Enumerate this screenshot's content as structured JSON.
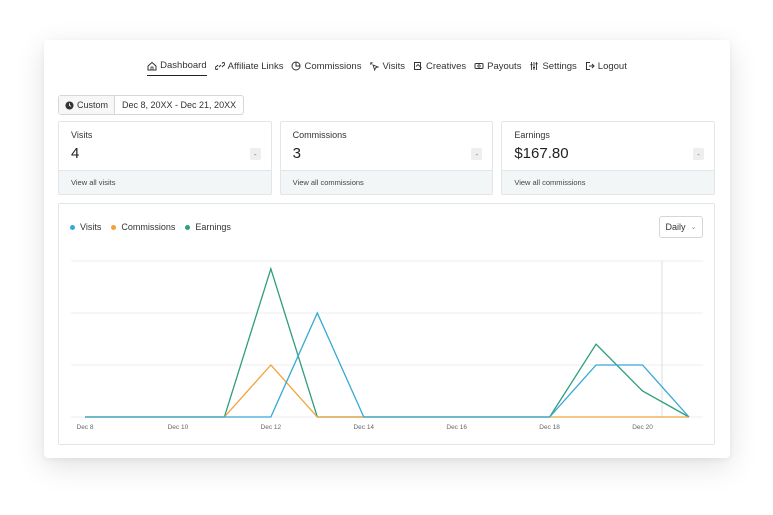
{
  "nav": {
    "items": [
      {
        "label": "Dashboard",
        "icon": "home-icon",
        "active": true
      },
      {
        "label": "Affiliate Links",
        "icon": "link-icon",
        "active": false
      },
      {
        "label": "Commissions",
        "icon": "pie-icon",
        "active": false
      },
      {
        "label": "Visits",
        "icon": "cursor-click-icon",
        "active": false
      },
      {
        "label": "Creatives",
        "icon": "image-icon",
        "active": false
      },
      {
        "label": "Payouts",
        "icon": "money-icon",
        "active": false
      },
      {
        "label": "Settings",
        "icon": "sliders-icon",
        "active": false
      },
      {
        "label": "Logout",
        "icon": "logout-icon",
        "active": false
      }
    ]
  },
  "date_range": {
    "preset": "Custom",
    "range": "Dec 8, 20XX - Dec 21, 20XX"
  },
  "stats": [
    {
      "label": "Visits",
      "value": "4",
      "chip": "-",
      "link": "View all visits"
    },
    {
      "label": "Commissions",
      "value": "3",
      "chip": "-",
      "link": "View all commissions"
    },
    {
      "label": "Earnings",
      "value": "$167.80",
      "chip": "-",
      "link": "View all commissions"
    }
  ],
  "interval": "Daily",
  "colors": {
    "visits": "#36a8d6",
    "commissions": "#f0a33a",
    "earnings": "#2e9e7e",
    "grid": "#ececec"
  },
  "chart_data": {
    "type": "line",
    "x": [
      "Dec 8",
      "Dec 9",
      "Dec 10",
      "Dec 11",
      "Dec 12",
      "Dec 13",
      "Dec 14",
      "Dec 15",
      "Dec 16",
      "Dec 17",
      "Dec 18",
      "Dec 19",
      "Dec 20",
      "Dec 21"
    ],
    "x_tick_labels": [
      "Dec 8",
      "Dec 10",
      "Dec 12",
      "Dec 14",
      "Dec 16",
      "Dec 18",
      "Dec 20"
    ],
    "series": [
      {
        "name": "Visits",
        "color": "#36a8d6",
        "values": [
          0,
          0,
          0,
          0,
          0,
          0,
          0,
          0,
          0,
          0,
          0,
          0,
          0,
          0,
          0,
          0,
          0,
          0,
          0,
          0,
          0,
          0,
          0,
          0,
          0,
          0,
          0
        ],
        "points": [
          [
            0,
            0
          ],
          [
            1,
            0
          ],
          [
            2,
            0
          ],
          [
            3,
            0
          ],
          [
            4,
            0
          ],
          [
            5,
            2
          ],
          [
            6,
            0
          ],
          [
            7,
            0
          ],
          [
            8,
            0
          ],
          [
            9,
            0
          ],
          [
            10,
            0
          ],
          [
            11,
            1
          ],
          [
            12,
            1
          ],
          [
            13,
            0
          ]
        ]
      },
      {
        "name": "Commissions",
        "color": "#f0a33a",
        "points": [
          [
            0,
            0
          ],
          [
            1,
            0
          ],
          [
            2,
            0
          ],
          [
            3,
            0
          ],
          [
            4,
            1
          ],
          [
            5,
            0
          ],
          [
            6,
            0
          ],
          [
            7,
            0
          ],
          [
            8,
            0
          ],
          [
            9,
            0
          ],
          [
            10,
            0
          ],
          [
            11,
            0
          ],
          [
            12,
            0
          ],
          [
            13,
            0
          ]
        ]
      },
      {
        "name": "Earnings",
        "color": "#2e9e7e",
        "points": [
          [
            0,
            0
          ],
          [
            1,
            0
          ],
          [
            2,
            0
          ],
          [
            3,
            0
          ],
          [
            4,
            2.85
          ],
          [
            5,
            0
          ],
          [
            6,
            0
          ],
          [
            7,
            0
          ],
          [
            8,
            0
          ],
          [
            9,
            0
          ],
          [
            10,
            0
          ],
          [
            11,
            1.4
          ],
          [
            12,
            0.5
          ],
          [
            13,
            0
          ]
        ]
      }
    ],
    "ylim": [
      0,
      3
    ],
    "grid": true,
    "legend": "top-left"
  }
}
